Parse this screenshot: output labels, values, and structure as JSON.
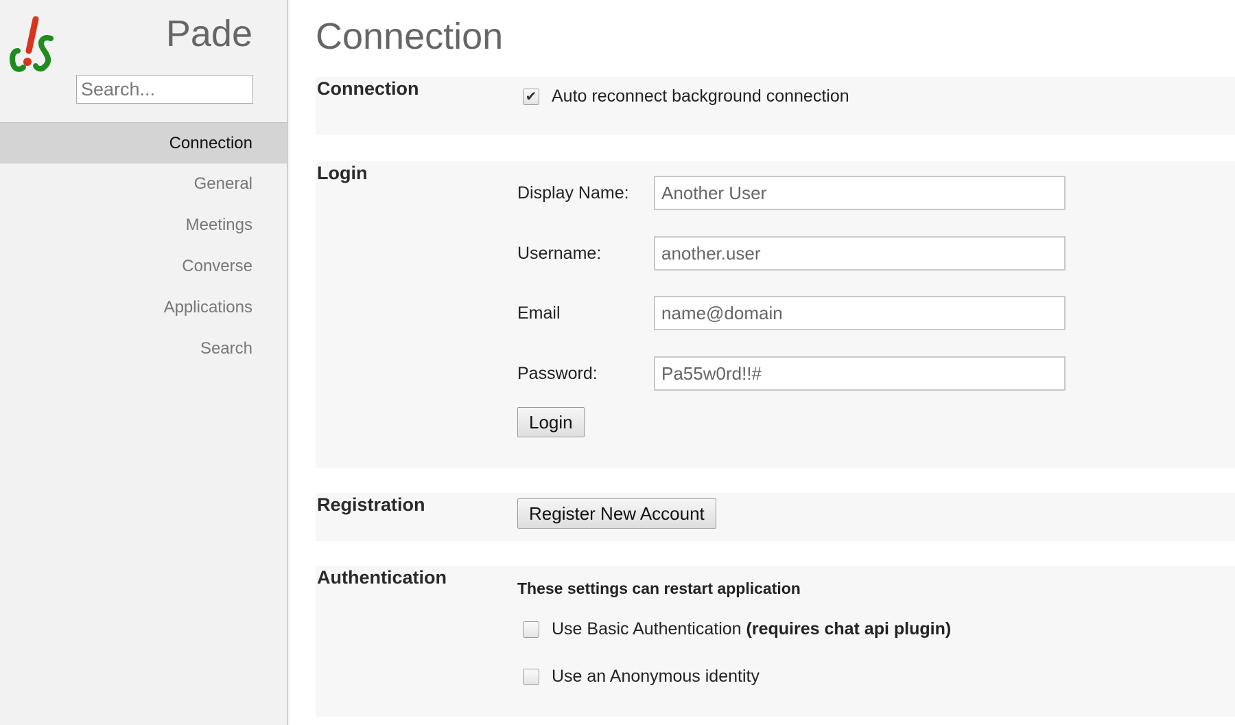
{
  "sidebar": {
    "app_title": "Pade",
    "search_placeholder": "Search...",
    "items": [
      {
        "label": "Connection"
      },
      {
        "label": "General"
      },
      {
        "label": "Meetings"
      },
      {
        "label": "Converse"
      },
      {
        "label": "Applications"
      },
      {
        "label": "Search"
      }
    ],
    "active_item": "Connection"
  },
  "main": {
    "page_title": "Connection",
    "connection": {
      "heading": "Connection",
      "auto_reconnect_label": "Auto reconnect background connection",
      "auto_reconnect_checked": true
    },
    "login": {
      "heading": "Login",
      "display_name_label": "Display Name:",
      "display_name_value": "Another User",
      "username_label": "Username:",
      "username_value": "another.user",
      "email_label": "Email",
      "email_value": "name@domain",
      "password_label": "Password:",
      "password_value": "Pa55w0rd!!#",
      "login_button": "Login"
    },
    "registration": {
      "heading": "Registration",
      "register_button": "Register New Account"
    },
    "authentication": {
      "heading": "Authentication",
      "notice": "These settings can restart application",
      "basic_auth_label": "Use Basic Authentication",
      "basic_auth_note": "(requires chat api plugin)",
      "basic_auth_checked": false,
      "anonymous_label": "Use an Anonymous identity",
      "anonymous_checked": false
    }
  },
  "colors": {
    "sidebar_bg": "#f2f2f2",
    "active_item_bg": "#d4d4d4",
    "section_bg": "#f7f7f7",
    "title_gray": "#666666"
  }
}
